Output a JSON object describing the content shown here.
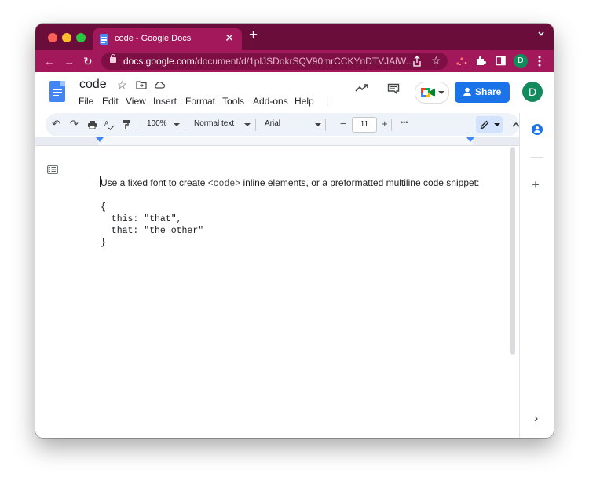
{
  "browser": {
    "tab_title": "code - Google Docs",
    "tab_close": "✕",
    "new_tab": "+",
    "url_host": "docs.google.com",
    "url_path": "/document/d/1plJSDokrSQV90mrCCKYnDTVJAiW...",
    "profile_initial": "D",
    "colors": {
      "frame": "#6b0d3a",
      "tab": "#a3185a"
    }
  },
  "docs": {
    "title": "code",
    "menu": [
      "File",
      "Edit",
      "View",
      "Insert",
      "Format",
      "Tools",
      "Add-ons",
      "Help"
    ],
    "share_label": "Share",
    "avatar_initial": "D",
    "share_color": "#1a73e8"
  },
  "format_toolbar": {
    "zoom": "100%",
    "style": "Normal text",
    "font": "Arial",
    "font_size": "11",
    "more": "•••"
  },
  "document": {
    "line1_before": "Use a fixed font to create ",
    "line1_code": "<code>",
    "line1_after": " inline elements, or a preformatted multiline code snippet:",
    "code_lines": [
      "{",
      "  this: \"that\",",
      "  that: \"the other\"",
      "}"
    ]
  },
  "side_panel": {
    "add": "+",
    "expand": "›"
  }
}
